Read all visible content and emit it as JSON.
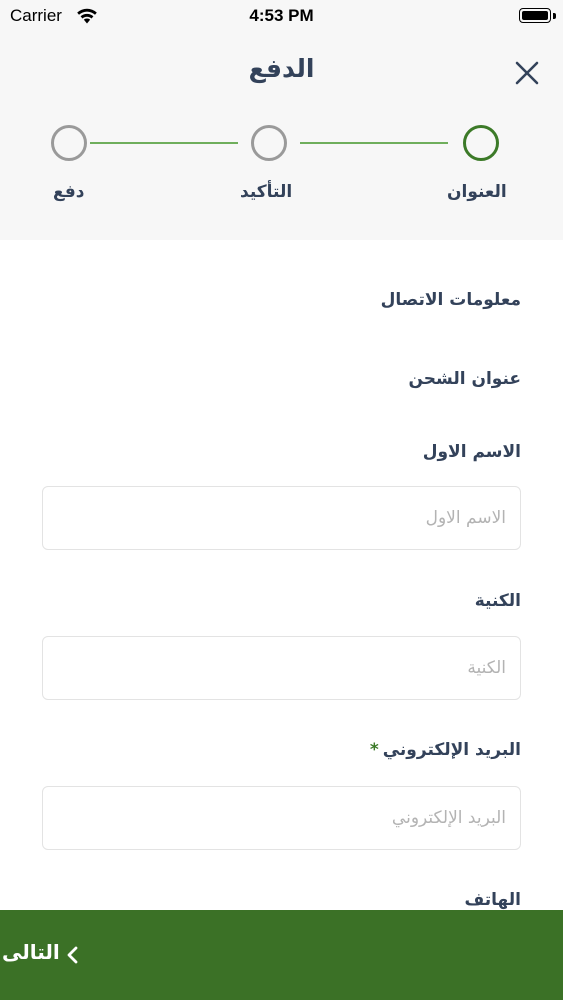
{
  "status_bar": {
    "carrier": "Carrier",
    "time": "4:53 PM"
  },
  "header": {
    "title": "الدفع",
    "close_icon": "close-icon"
  },
  "stepper": {
    "steps": [
      {
        "label": "العنوان",
        "state": "active"
      },
      {
        "label": "التأكيد",
        "state": "inactive"
      },
      {
        "label": "دفع",
        "state": "inactive"
      }
    ],
    "active_color": "#3c7a28",
    "inactive_color": "#9a9a9a",
    "line_color": "#6fae5c"
  },
  "form": {
    "contact_info_title": "معلومات الاتصال",
    "shipping_address_title": "عنوان الشحن",
    "fields": [
      {
        "label": "الاسم الاول",
        "placeholder": "الاسم الاول",
        "value": "",
        "required": false
      },
      {
        "label": "الكنية",
        "placeholder": "الكنية",
        "value": "",
        "required": false
      },
      {
        "label": "البريد الإلكتروني",
        "placeholder": "البريد الإلكتروني",
        "value": "",
        "required": true,
        "required_mark": "*"
      },
      {
        "label": "الهاتف",
        "placeholder": "",
        "value": "",
        "required": false
      }
    ]
  },
  "footer": {
    "next_label": "التالى",
    "next_icon": "chevron-left-icon",
    "background_color": "#3b7126"
  }
}
